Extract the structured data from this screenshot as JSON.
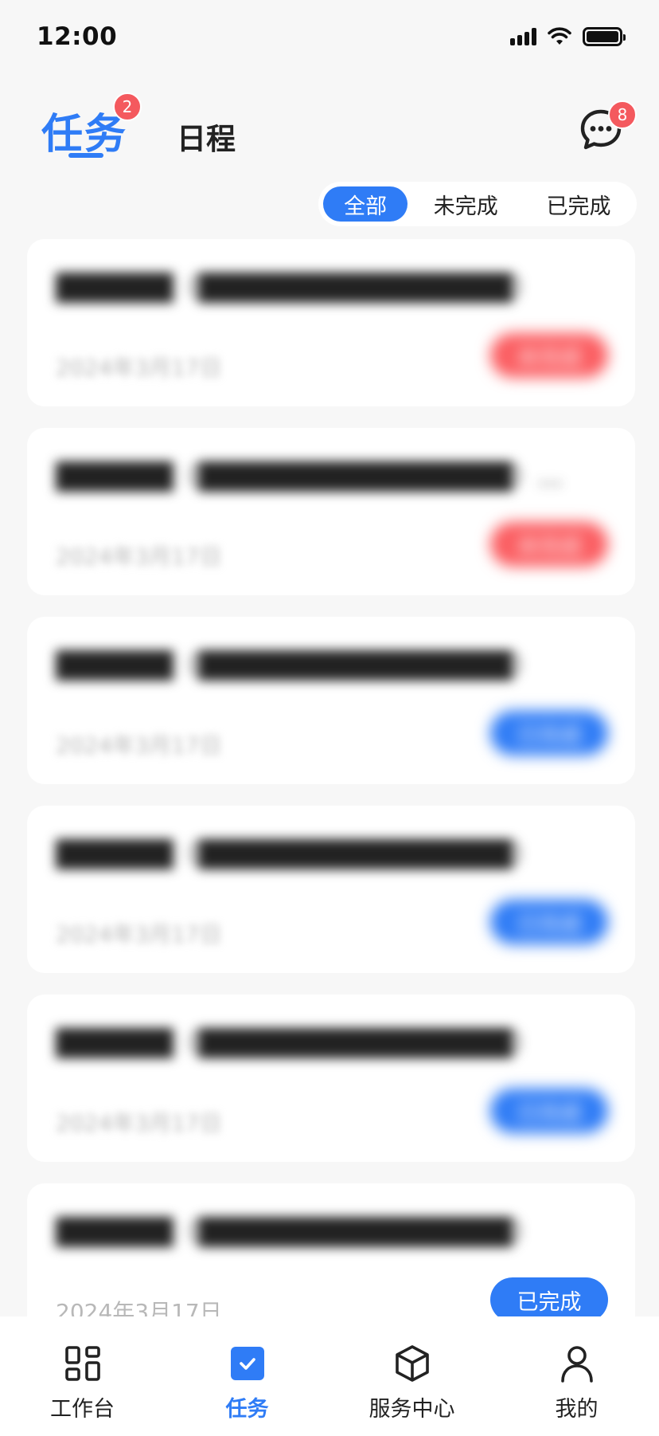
{
  "status_bar": {
    "time": "12:00"
  },
  "header": {
    "tab_task": "任务",
    "tab_task_badge": "2",
    "tab_schedule": "日程",
    "message_badge": "8"
  },
  "filter": {
    "options": [
      "全部",
      "未完成",
      "已完成"
    ],
    "selected": "全部"
  },
  "tasks": [
    {
      "title": "██████（████████████████）",
      "date": "2024年3月17日",
      "status": "未完成",
      "status_color": "#fb5e62"
    },
    {
      "title": "██████（████████████████）████…",
      "date": "2024年3月17日",
      "status": "未完成",
      "status_color": "#fb5e62"
    },
    {
      "title": "██████（████████████████）",
      "date": "2024年3月17日",
      "status": "已完成",
      "status_color": "#2f7cf6"
    },
    {
      "title": "██████（████████████████）",
      "date": "2024年3月17日",
      "status": "已完成",
      "status_color": "#2f7cf6"
    },
    {
      "title": "██████（████████████████）",
      "date": "2024年3月17日",
      "status": "已完成",
      "status_color": "#2f7cf6"
    },
    {
      "title": "██████（████████████████）",
      "date": "2024年3月17日",
      "status": "已完成",
      "status_color": "#2f7cf6"
    }
  ],
  "bottom_nav": [
    {
      "label": "工作台",
      "icon": "grid-icon",
      "active": false
    },
    {
      "label": "任务",
      "icon": "check-square-icon",
      "active": true
    },
    {
      "label": "服务中心",
      "icon": "cube-icon",
      "active": false
    },
    {
      "label": "我的",
      "icon": "person-icon",
      "active": false
    }
  ],
  "colors": {
    "accent": "#2f7cf6",
    "alert": "#fb5e62",
    "background": "#f7f7f7"
  }
}
